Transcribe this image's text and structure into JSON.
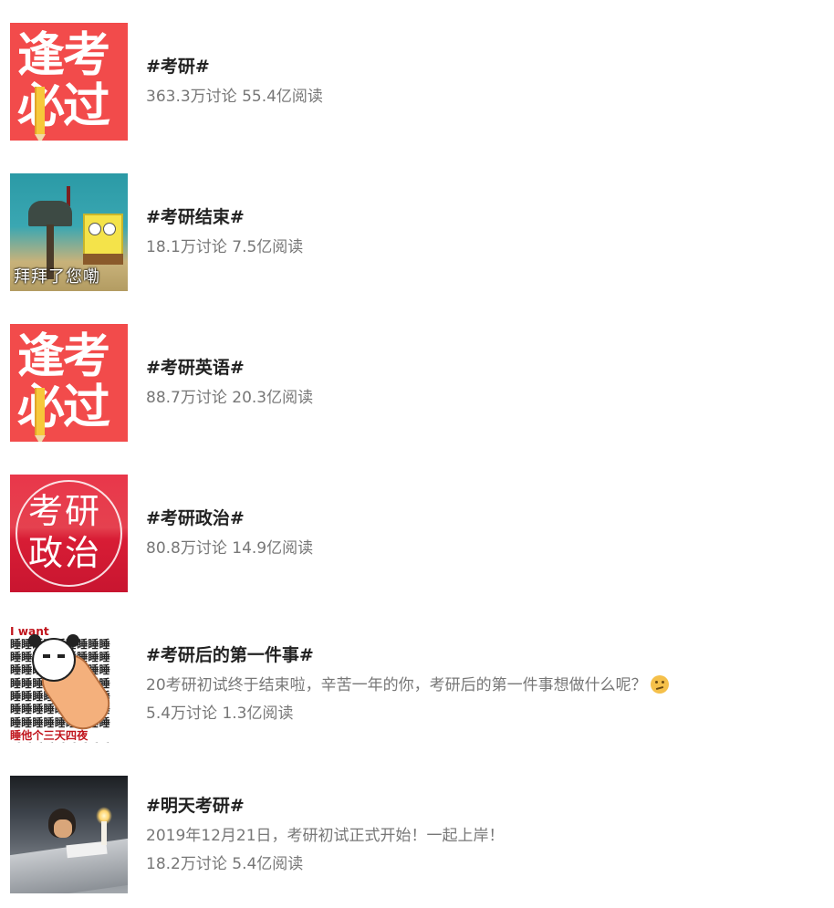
{
  "topics": [
    {
      "title": "#考研#",
      "stats": "363.3万讨论 55.4亿阅读",
      "thumb": "red-icon-逢考必过",
      "thumb_text": [
        "逢考",
        "必过"
      ]
    },
    {
      "title": "#考研结束#",
      "stats": "18.1万讨论 7.5亿阅读",
      "thumb": "spongebob-meme",
      "thumb_text": [
        "拜拜了您嘞"
      ]
    },
    {
      "title": "#考研英语#",
      "stats": "88.7万讨论 20.3亿阅读",
      "thumb": "red-icon-逢考必过",
      "thumb_text": [
        "逢考",
        "必过"
      ]
    },
    {
      "title": "#考研政治#",
      "stats": "80.8万讨论 14.9亿阅读",
      "thumb": "red-circle-考研政治",
      "thumb_text": [
        "考研",
        "政治"
      ]
    },
    {
      "title": "#考研后的第一件事#",
      "description": "20考研初试终于结束啦，辛苦一年的你，考研后的第一件事想做什么呢？",
      "stats": "5.4万讨论 1.3亿阅读",
      "thumb": "panda-sleep-meme",
      "thumb_text": [
        "I want",
        "睡他个三天四夜"
      ]
    },
    {
      "title": "#明天考研#",
      "description": "2019年12月21日，考研初试正式开始！一起上岸！",
      "stats": "18.2万讨论 5.4亿阅读",
      "thumb": "candle-study-photo"
    }
  ],
  "colors": {
    "title": "#222222",
    "meta": "#777777",
    "thumb_red": "#f24b4b"
  },
  "icons": {
    "description_emoji": "thinking-face-icon"
  }
}
